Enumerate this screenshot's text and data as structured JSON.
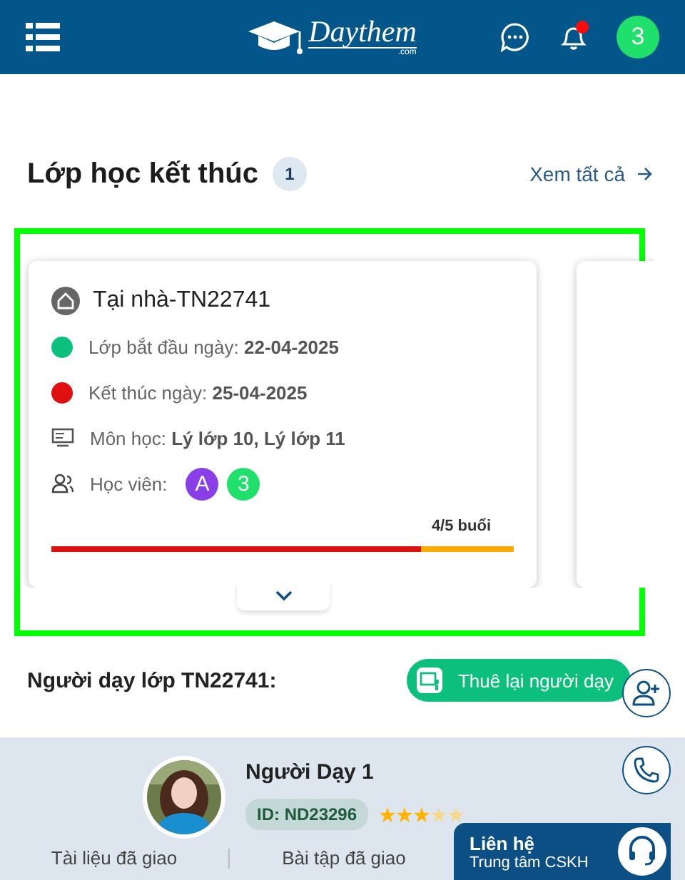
{
  "header": {
    "logo_text": "Daythem",
    "logo_sub": ".com",
    "notification_dot": true,
    "avatar_letter": "3"
  },
  "section": {
    "title": "Lớp học kết thúc",
    "count": "1",
    "view_all": "Xem tất cả"
  },
  "class_card": {
    "highlighted": true,
    "title": "Tại nhà-TN22741",
    "rows": [
      {
        "kind": "dot",
        "color": "#0cbf7c",
        "label": "Lớp bắt đầu ngày:",
        "value": "22-04-2025"
      },
      {
        "kind": "dot",
        "color": "#e01010",
        "label": "Kết thúc ngày:",
        "value": "25-04-2025"
      },
      {
        "kind": "subject",
        "label": "Môn học:",
        "value": "Lý lớp 10, Lý lớp 11"
      }
    ],
    "students": {
      "label": "Học viên:",
      "avatars": [
        {
          "letter": "A",
          "color": "#8a3ee8"
        },
        {
          "letter": "3",
          "color": "#1fe06a"
        }
      ]
    },
    "progress": {
      "reading": "4/5 buổi",
      "level": 0.8
    }
  },
  "teacher_section": {
    "title": "Người dạy lớp TN22741:",
    "rehire_button": "Thuê lại người dạy"
  },
  "teacher": {
    "name": "Người Dạy 1",
    "id": "ID: ND23296",
    "stars": 3,
    "tabs": [
      {
        "label": "Tài liệu đã giao",
        "selected": false
      },
      {
        "label": "Bài tập đã giao",
        "selected": false
      }
    ]
  },
  "contact": {
    "title": "Liên hệ",
    "subtitle": "Trung tâm CSKH"
  }
}
